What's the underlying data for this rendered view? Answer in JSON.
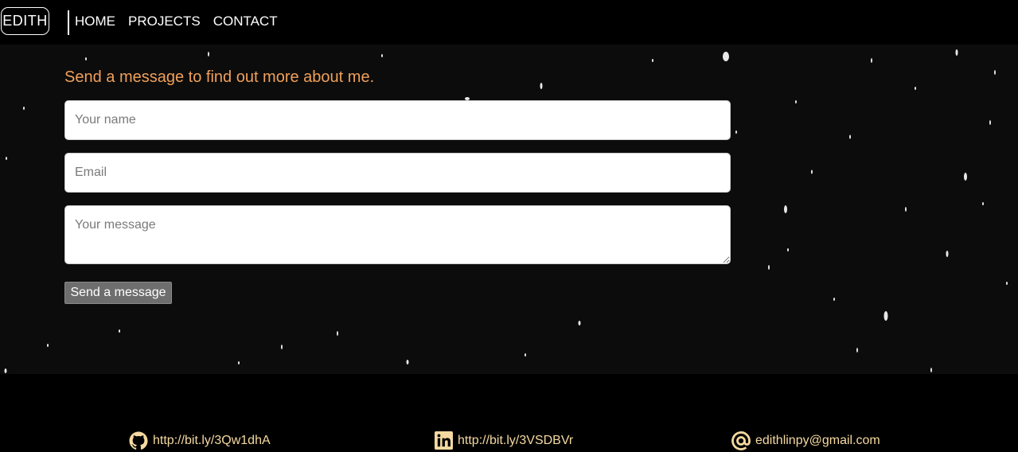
{
  "nav": {
    "brand": "EDITH",
    "links": [
      "HOME",
      "PROJECTS",
      "CONTACT"
    ]
  },
  "contact_form": {
    "heading": "Send a message to find out more about me.",
    "name_placeholder": "Your name",
    "email_placeholder": "Email",
    "message_placeholder": "Your message",
    "submit_label": "Send a message"
  },
  "footer": {
    "github": {
      "icon": "github-icon",
      "text": "http://bit.ly/3Qw1dhA"
    },
    "linkedin": {
      "icon": "linkedin-icon",
      "text": "http://bit.ly/3VSDBVr"
    },
    "email": {
      "icon": "at-sign-icon",
      "text": "edithlinpy@gmail.com"
    }
  },
  "colors": {
    "background": "#000000",
    "heading_accent": "#f0a05a",
    "footer_text": "#f5d9a0",
    "button": "#6e6e6e"
  }
}
